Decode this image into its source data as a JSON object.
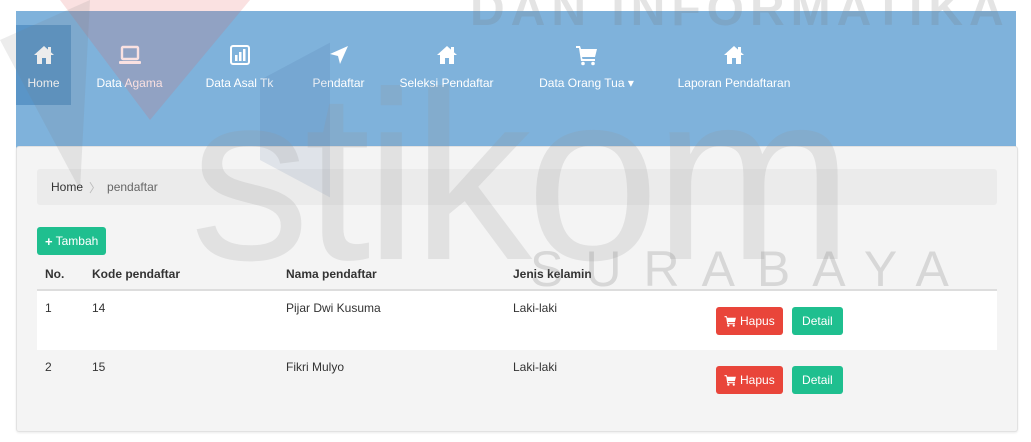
{
  "nav": {
    "items": [
      {
        "label": "Home",
        "icon": "home-icon",
        "active": true
      },
      {
        "label": "Data Agama",
        "icon": "laptop-icon",
        "active": false
      },
      {
        "label": "Data Asal Tk",
        "icon": "bar-chart-icon",
        "active": false
      },
      {
        "label": "Pendaftar",
        "icon": "send-icon",
        "active": false
      },
      {
        "label": "Seleksi Pendaftar",
        "icon": "home-icon",
        "active": false
      },
      {
        "label": "Data Orang Tua ▾",
        "icon": "cart-icon",
        "active": false
      },
      {
        "label": "Laporan Pendaftaran",
        "icon": "home-icon",
        "active": false
      }
    ]
  },
  "breadcrumb": {
    "home": "Home",
    "separator": "〉",
    "current": "pendaftar"
  },
  "add_button": {
    "label": "Tambah"
  },
  "table": {
    "headers": {
      "no": "No.",
      "kode": "Kode pendaftar",
      "nama": "Nama pendaftar",
      "jk": "Jenis kelamin"
    },
    "rows": [
      {
        "no": "1",
        "kode": "14",
        "nama": "Pijar Dwi Kusuma",
        "jk": "Laki-laki",
        "hapus": "Hapus",
        "detail": "Detail"
      },
      {
        "no": "2",
        "kode": "15",
        "nama": "Fikri Mulyo",
        "jk": "Laki-laki",
        "hapus": "Hapus",
        "detail": "Detail"
      }
    ]
  },
  "watermark": {
    "top": "DAN INFORMATIKA",
    "main": "stikom",
    "sub": "SURABAYA"
  },
  "colors": {
    "navbar": "#7fb2db",
    "nav_active": "#5a95c7",
    "success": "#1fbf8f",
    "danger": "#e9453a"
  }
}
